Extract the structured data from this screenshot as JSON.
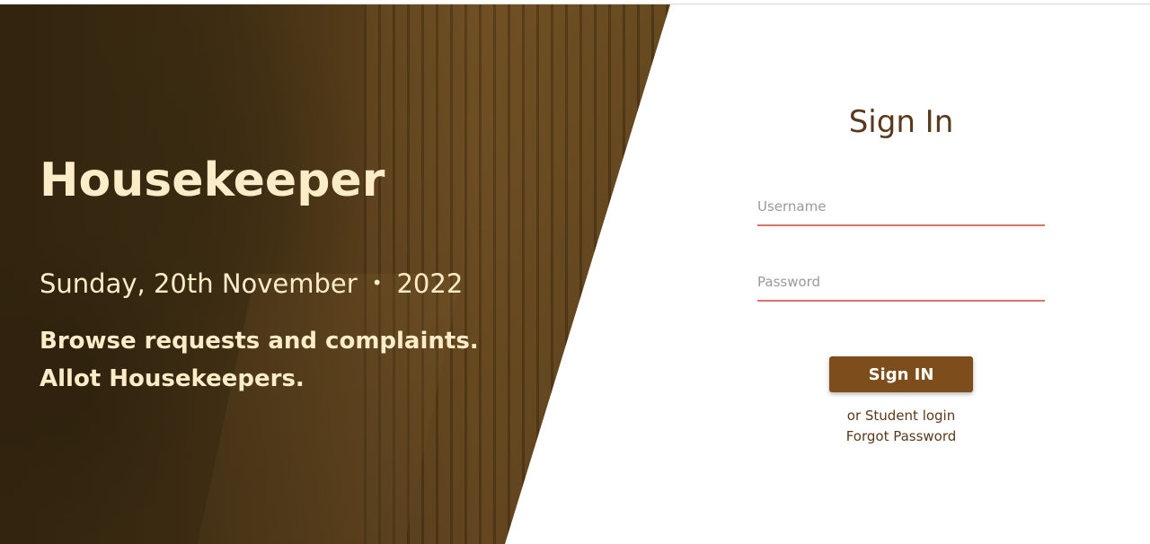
{
  "hero": {
    "brand": "Housekeeper",
    "date": "Sunday, 20th November",
    "separator": "•",
    "year": "2022",
    "tagline_line1": "Browse requests and complaints.",
    "tagline_line2": "Allot Housekeepers."
  },
  "signin": {
    "title": "Sign In",
    "username_placeholder": "Username",
    "password_placeholder": "Password",
    "submit_label": "Sign IN",
    "student_login_label": "or Student login",
    "forgot_password_label": "Forgot Password"
  },
  "colors": {
    "hero_text": "#fdecc8",
    "accent_brown": "#7d4e1b",
    "title_brown": "#5a3a1c",
    "input_underline": "#d9736c"
  }
}
